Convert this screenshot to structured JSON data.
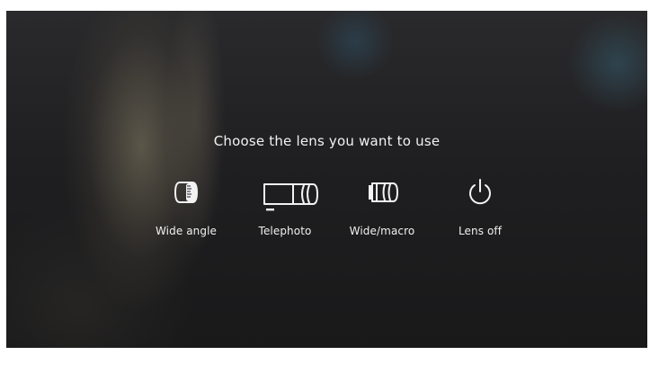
{
  "prompt": "Choose the lens you want to use",
  "options": [
    {
      "label": "Wide angle",
      "icon": "wide-angle-lens-icon"
    },
    {
      "label": "Telephoto",
      "icon": "telephoto-lens-icon"
    },
    {
      "label": "Wide/macro",
      "icon": "wide-macro-lens-icon"
    },
    {
      "label": "Lens off",
      "icon": "power-icon"
    }
  ],
  "colors": {
    "foreground": "#f2f2f2",
    "background": "#1f1f21"
  }
}
